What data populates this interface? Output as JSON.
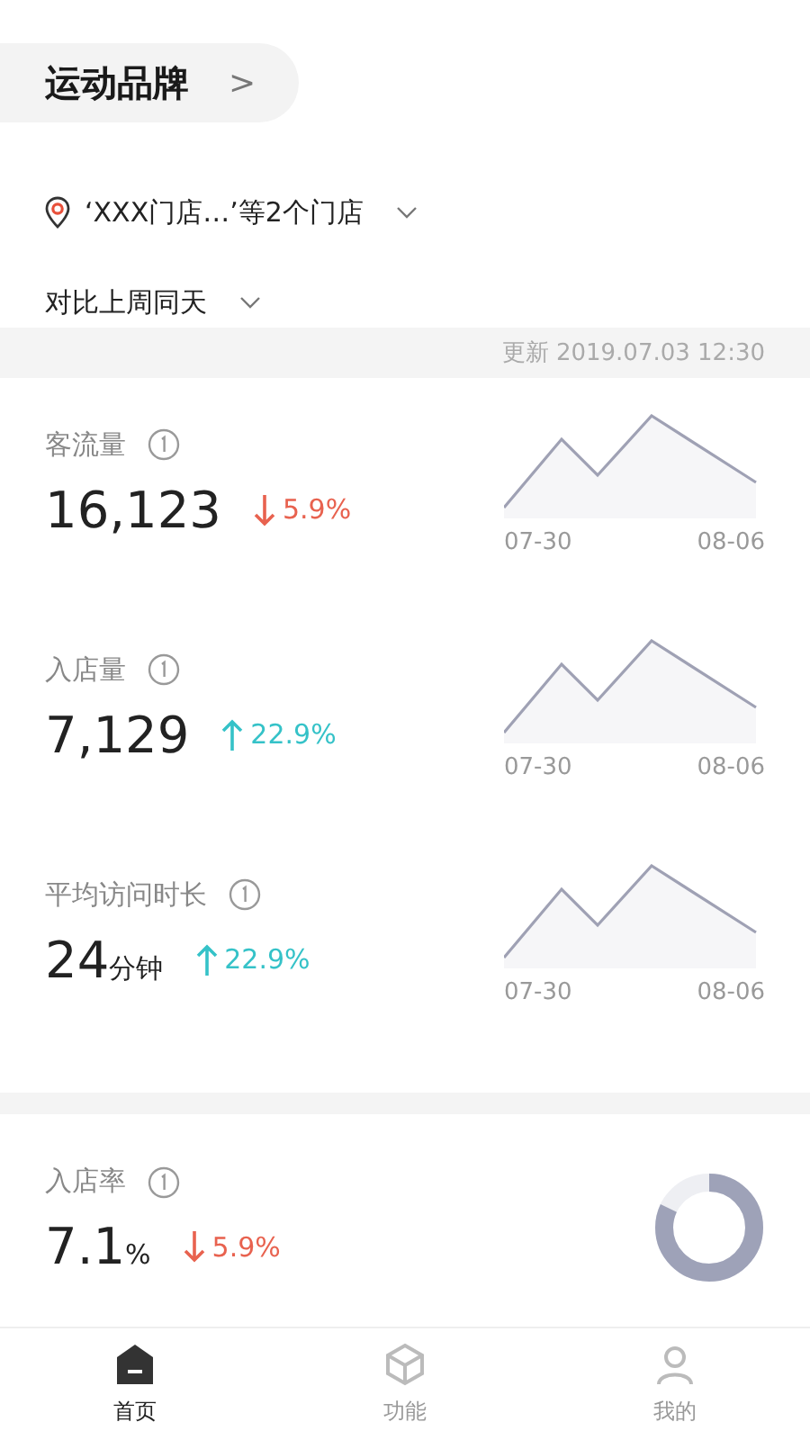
{
  "brand": {
    "title": "运动品牌",
    "chevron": ">"
  },
  "store_filter": {
    "label": "‘XXX门店…’等2个门店"
  },
  "compare_filter": {
    "label": "对比上周同天"
  },
  "update_time": "更新 2019.07.03 12:30",
  "metrics": [
    {
      "kind": "sparkline",
      "label": "客流量",
      "value": "16,123",
      "rising": false,
      "change": "5.9%",
      "x_start": "07-30",
      "x_end": "08-06"
    },
    {
      "kind": "sparkline",
      "label": "入店量",
      "value": "7,129",
      "rising": true,
      "change": "22.9%",
      "x_start": "07-30",
      "x_end": "08-06"
    },
    {
      "kind": "sparkline",
      "label": "平均访问时长",
      "value": "24",
      "unit": "分钟",
      "rising": true,
      "change": "22.9%",
      "x_start": "07-30",
      "x_end": "08-06"
    }
  ],
  "rate_metric": {
    "kind": "donut",
    "label": "入店率",
    "value": "7.1",
    "unit": "%",
    "rising": false,
    "change": "5.9%",
    "level": 0.82
  },
  "tabs": [
    {
      "label": "首页",
      "kind": "home",
      "selected": true
    },
    {
      "label": "功能",
      "kind": "box",
      "selected": false
    },
    {
      "label": "我的",
      "kind": "person",
      "selected": false
    }
  ]
}
